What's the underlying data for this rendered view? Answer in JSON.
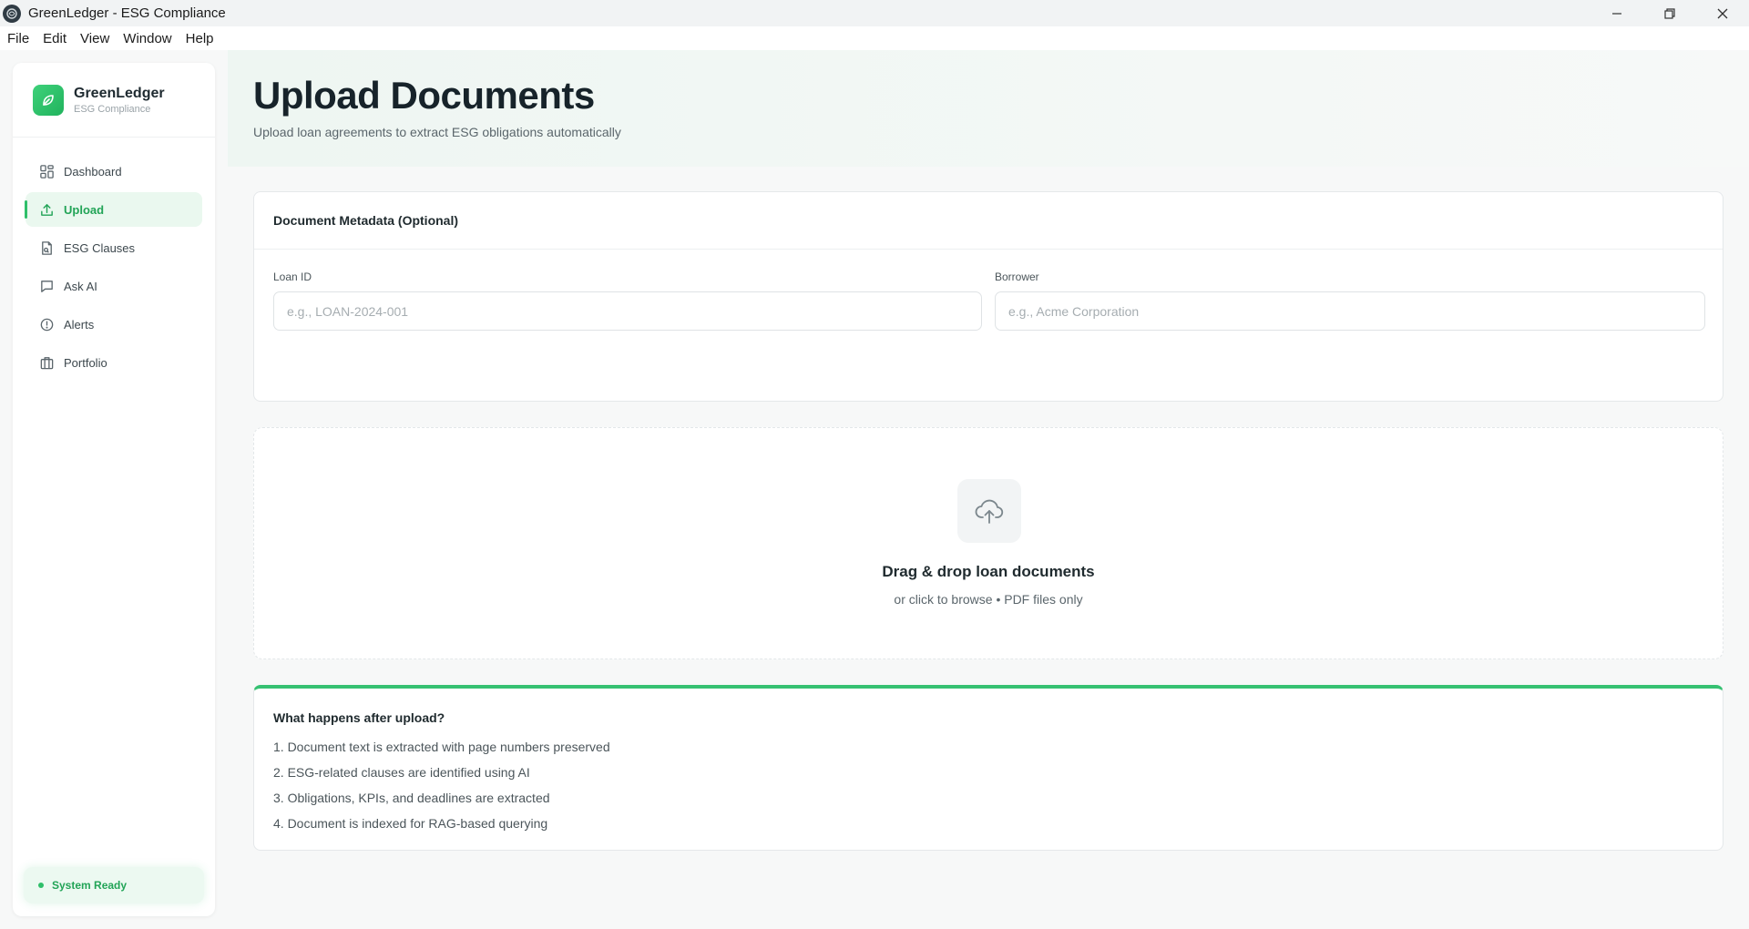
{
  "window": {
    "title": "GreenLedger - ESG Compliance",
    "controls": [
      "minimize-icon",
      "restore-icon",
      "close-icon"
    ]
  },
  "menu": [
    "File",
    "Edit",
    "View",
    "Window",
    "Help"
  ],
  "sidebar": {
    "brand_name": "GreenLedger",
    "brand_sub": "ESG Compliance",
    "items": [
      {
        "label": "Dashboard",
        "icon": "dashboard-icon",
        "active": false
      },
      {
        "label": "Upload",
        "icon": "upload-icon",
        "active": true
      },
      {
        "label": "ESG Clauses",
        "icon": "document-icon",
        "active": false
      },
      {
        "label": "Ask AI",
        "icon": "chat-icon",
        "active": false
      },
      {
        "label": "Alerts",
        "icon": "alert-icon",
        "active": false
      },
      {
        "label": "Portfolio",
        "icon": "briefcase-icon",
        "active": false
      }
    ],
    "status": "System Ready"
  },
  "header": {
    "title": "Upload Documents",
    "subtitle": "Upload loan agreements to extract ESG obligations automatically"
  },
  "metadata": {
    "title": "Document Metadata (Optional)",
    "loan_id": {
      "label": "Loan ID",
      "placeholder": "e.g., LOAN-2024-001",
      "value": ""
    },
    "borrower": {
      "label": "Borrower",
      "placeholder": "e.g., Acme Corporation",
      "value": ""
    }
  },
  "dropzone": {
    "icon": "cloud-upload-icon",
    "title": "Drag & drop loan documents",
    "subtitle": "or click to browse • PDF files only"
  },
  "info": {
    "title": "What happens after upload?",
    "steps": [
      "1. Document text is extracted with page numbers preserved",
      "2. ESG-related clauses are identified using AI",
      "3. Obligations, KPIs, and deadlines are extracted",
      "4. Document is indexed for RAG-based querying"
    ]
  },
  "colors": {
    "accent": "#2fbf6a",
    "accent_dark": "#22a457",
    "active_bg": "#eaf8ef"
  }
}
